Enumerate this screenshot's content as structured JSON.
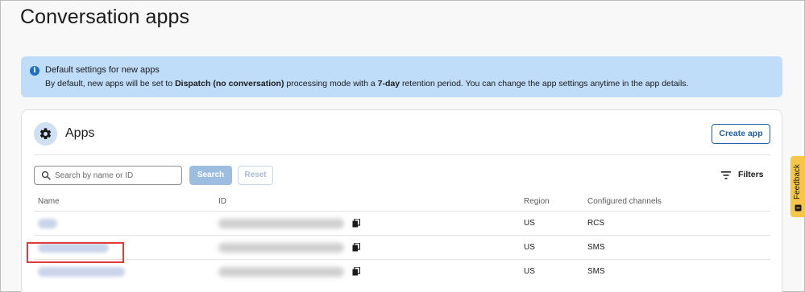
{
  "page": {
    "title": "Conversation apps"
  },
  "banner": {
    "title": "Default settings for new apps",
    "text_1": "By default, new apps will be set to ",
    "mode": "Dispatch (no conversation)",
    "text_2": " processing mode with a ",
    "retention": "7-day",
    "text_3": " retention period. You can change the app settings anytime in the app details.",
    "icon": "info-icon"
  },
  "apps": {
    "title": "Apps",
    "icon": "gear-icon",
    "create_label": "Create app",
    "search_placeholder": "Search by name or ID",
    "search_label": "Search",
    "reset_label": "Reset",
    "filters_label": "Filters"
  },
  "table": {
    "columns": [
      "Name",
      "ID",
      "Region",
      "Configured channels"
    ],
    "rows": [
      {
        "name": "",
        "id": "",
        "region": "US",
        "channels": "RCS"
      },
      {
        "name": "",
        "id": "",
        "region": "US",
        "channels": "SMS"
      },
      {
        "name": "",
        "id": "",
        "region": "US",
        "channels": "SMS"
      }
    ]
  },
  "feedback": {
    "label": "Feedback"
  },
  "colors": {
    "accent": "#1e5fa7",
    "banner_bg": "#bfdcf8",
    "highlight": "#e03a3a",
    "feedback_bg": "#f7c548"
  }
}
